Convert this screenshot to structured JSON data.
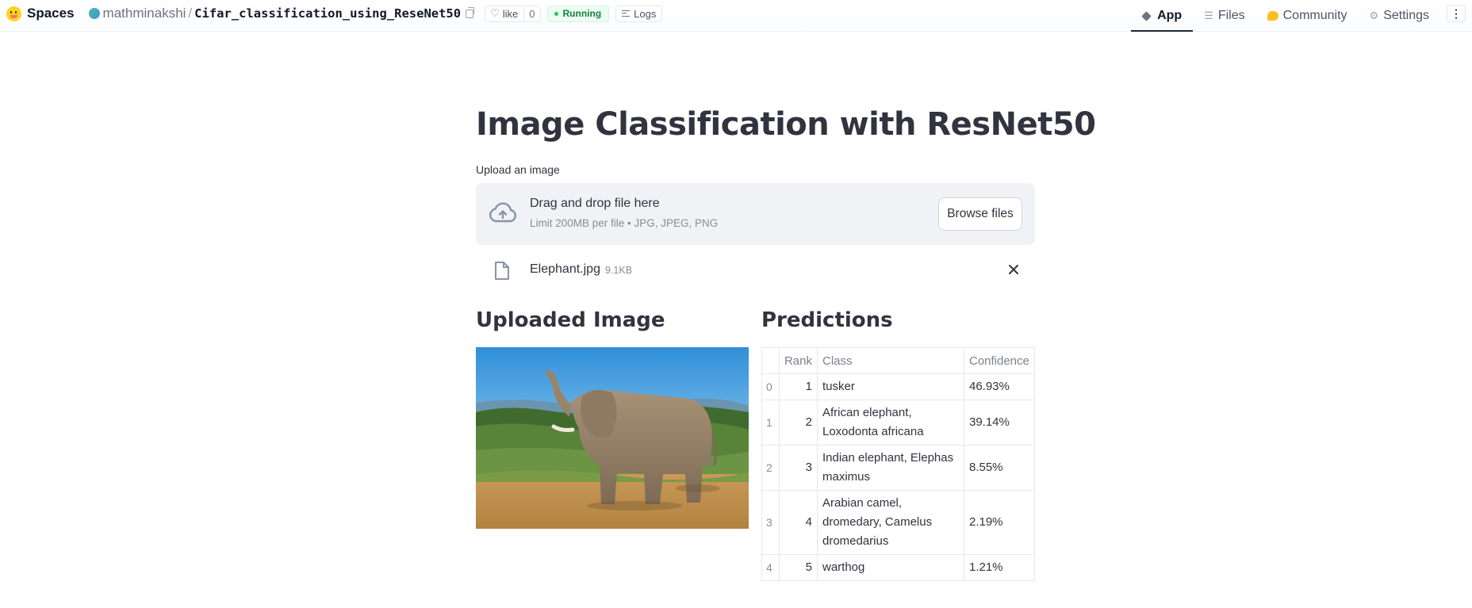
{
  "topbar": {
    "brand": "Spaces",
    "owner": "mathminakshi",
    "separator": "/",
    "repo": "Cifar_classification_using_ReseNet50",
    "like_label": "like",
    "like_count": "0",
    "status": "Running",
    "logs_label": "Logs",
    "nav": {
      "app": "App",
      "files": "Files",
      "community": "Community",
      "settings": "Settings"
    },
    "more_label": "⋮"
  },
  "main": {
    "title": "Image Classification with ResNet50",
    "upload": {
      "label": "Upload an image",
      "drop_title": "Drag and drop file here",
      "drop_sub": "Limit 200MB per file • JPG, JPEG, PNG",
      "browse_label": "Browse files",
      "file_name": "Elephant.jpg",
      "file_size": "9.1KB"
    },
    "left_heading": "Uploaded Image",
    "right_heading": "Predictions",
    "table": {
      "headers": [
        "",
        "Rank",
        "Class",
        "Confidence"
      ],
      "rows": [
        {
          "index": "0",
          "rank": "1",
          "class": "tusker",
          "confidence": "46.93%"
        },
        {
          "index": "1",
          "rank": "2",
          "class": "African elephant, Loxodonta africana",
          "confidence": "39.14%"
        },
        {
          "index": "2",
          "rank": "3",
          "class": "Indian elephant, Elephas maximus",
          "confidence": "8.55%"
        },
        {
          "index": "3",
          "rank": "4",
          "class": "Arabian camel, dromedary, Camelus dromedarius",
          "confidence": "2.19%"
        },
        {
          "index": "4",
          "rank": "5",
          "class": "warthog",
          "confidence": "1.21%"
        }
      ]
    }
  },
  "icons": {
    "logo": "hugging-face-logo",
    "upload": "cloud-upload-icon",
    "file": "file-icon",
    "close": "close-icon"
  },
  "colors": {
    "status_bg": "#ecfdf3",
    "status_text": "#15803d",
    "dropzone_bg": "#f0f2f6",
    "text": "#31333f"
  }
}
